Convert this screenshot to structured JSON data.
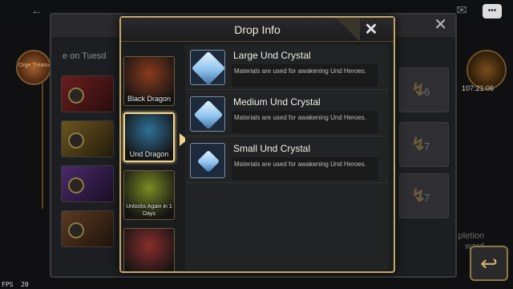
{
  "modal": {
    "title": "Drop Info",
    "close_icon": "close-x-icon"
  },
  "dragons": [
    {
      "name": "Black Dragon",
      "note": "",
      "selected": false,
      "color": "#8a3a1c"
    },
    {
      "name": "Und Dragon",
      "note": "",
      "selected": true,
      "color": "#2f6f96"
    },
    {
      "name": "",
      "note": "Unlocks Again in 1 Days",
      "selected": false,
      "color": "#7a8a22"
    },
    {
      "name": "",
      "note": "",
      "selected": false,
      "color": "#8a2d2d"
    }
  ],
  "items": [
    {
      "name": "Large Und Crystal",
      "description": "Materials are used for awakening Und Heroes."
    },
    {
      "name": "Medium Und Crystal",
      "description": "Materials are used for awakening Und Heroes."
    },
    {
      "name": "Small Und Crystal",
      "description": "Materials are used for awakening Und Heroes."
    }
  ],
  "background": {
    "subtitle": "e on Tuesd",
    "slots": [
      {
        "count": "6"
      },
      {
        "count": "7"
      },
      {
        "count": "7"
      }
    ],
    "completion_text": "pletion\nward",
    "lantern_label": "Orge Treasur"
  },
  "hud": {
    "clock": "107:21:06",
    "fps_label": "FPS",
    "fps_value": "20"
  },
  "colors": {
    "gold": "#c4a86a",
    "crystal": "#8fc4ee",
    "selected_border": "#f2d68a"
  }
}
